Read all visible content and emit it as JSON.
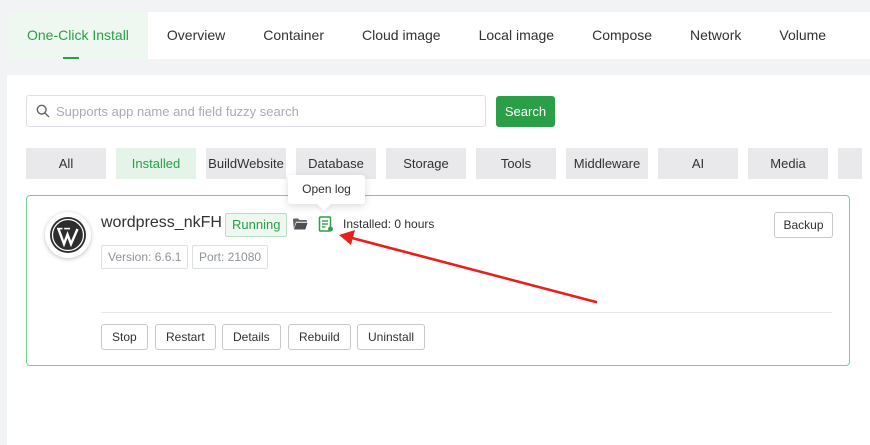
{
  "tabs": [
    {
      "label": "One-Click Install",
      "active": true
    },
    {
      "label": "Overview",
      "active": false
    },
    {
      "label": "Container",
      "active": false
    },
    {
      "label": "Cloud image",
      "active": false
    },
    {
      "label": "Local image",
      "active": false
    },
    {
      "label": "Compose",
      "active": false
    },
    {
      "label": "Network",
      "active": false
    },
    {
      "label": "Volume",
      "active": false
    }
  ],
  "search": {
    "placeholder": "Supports app name and field fuzzy search",
    "value": "",
    "button_label": "Search"
  },
  "filters": [
    {
      "label": "All",
      "active": false
    },
    {
      "label": "Installed",
      "active": true
    },
    {
      "label": "BuildWebsite",
      "active": false
    },
    {
      "label": "Database",
      "active": false
    },
    {
      "label": "Storage",
      "active": false
    },
    {
      "label": "Tools",
      "active": false
    },
    {
      "label": "Middleware",
      "active": false
    },
    {
      "label": "AI",
      "active": false
    },
    {
      "label": "Media",
      "active": false
    },
    {
      "label": "",
      "active": false
    }
  ],
  "tooltip": {
    "text": "Open log"
  },
  "app": {
    "name": "wordpress_nkFH",
    "status": "Running",
    "installed": "Installed: 0 hours",
    "version": "Version: 6.6.1",
    "port": "Port: 21080",
    "backup_label": "Backup",
    "actions": [
      "Stop",
      "Restart",
      "Details",
      "Rebuild",
      "Uninstall"
    ],
    "logo_icon": "wordpress-logo",
    "folder_icon": "folder-icon",
    "log_icon": "log-file-icon"
  },
  "colors": {
    "accent": "#2a9f47",
    "accent_light": "#eef7f0",
    "card_border": "#7fcc92",
    "annotation_arrow": "#e8201b"
  }
}
